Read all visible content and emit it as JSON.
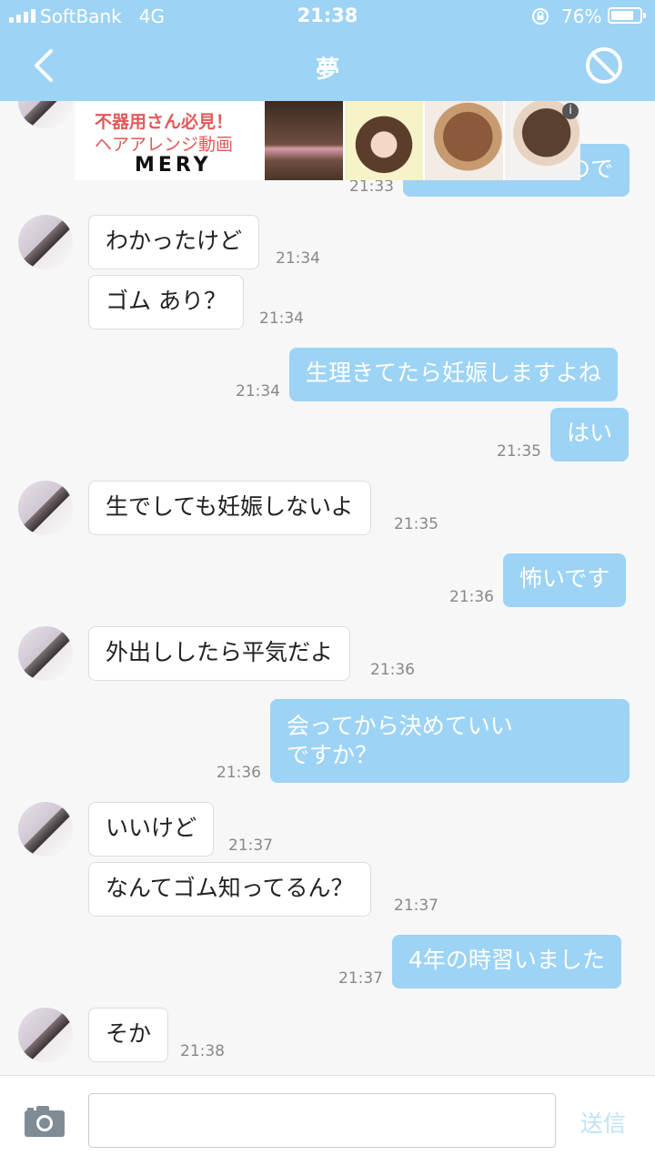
{
  "status": {
    "carrier": "SoftBank",
    "network": "4G",
    "time": "21:38",
    "battery_percent": "76%",
    "battery_level": 0.76
  },
  "nav": {
    "title": "夢",
    "back_icon": "chevron-left-icon",
    "block_icon": "block-icon"
  },
  "ad": {
    "line1": "不器用さん必見！",
    "line2": "ヘアアレンジ動画",
    "brand": "MERY",
    "info": "i"
  },
  "messages": [
    {
      "side": "out",
      "text": "ので",
      "time": "21:33"
    },
    {
      "side": "in",
      "text": "わかったけど",
      "time": "21:34"
    },
    {
      "side": "in",
      "text": "ゴム あり？",
      "time": "21:34"
    },
    {
      "side": "out",
      "text": "生理きてたら妊娠しますよね",
      "time": "21:34"
    },
    {
      "side": "out",
      "text": "はい",
      "time": "21:35"
    },
    {
      "side": "in",
      "text": "生でしても妊娠しないよ",
      "time": "21:35"
    },
    {
      "side": "out",
      "text": "怖いです",
      "time": "21:36"
    },
    {
      "side": "in",
      "text": "外出ししたら平気だよ",
      "time": "21:36"
    },
    {
      "side": "out",
      "text": "会ってから決めていいですか？",
      "lines": [
        "会ってから決めていい",
        "ですか？"
      ],
      "time": "21:36"
    },
    {
      "side": "in",
      "text": "いいけど",
      "time": "21:37"
    },
    {
      "side": "in",
      "text": "なんてゴム知ってるん？",
      "time": "21:37"
    },
    {
      "side": "out",
      "text": "4年の時習いました",
      "time": "21:37"
    },
    {
      "side": "in",
      "text": "そか",
      "time": "21:38"
    }
  ],
  "footer": {
    "camera_icon": "camera-icon",
    "input_value": "",
    "input_placeholder": "",
    "send_label": "送信"
  }
}
